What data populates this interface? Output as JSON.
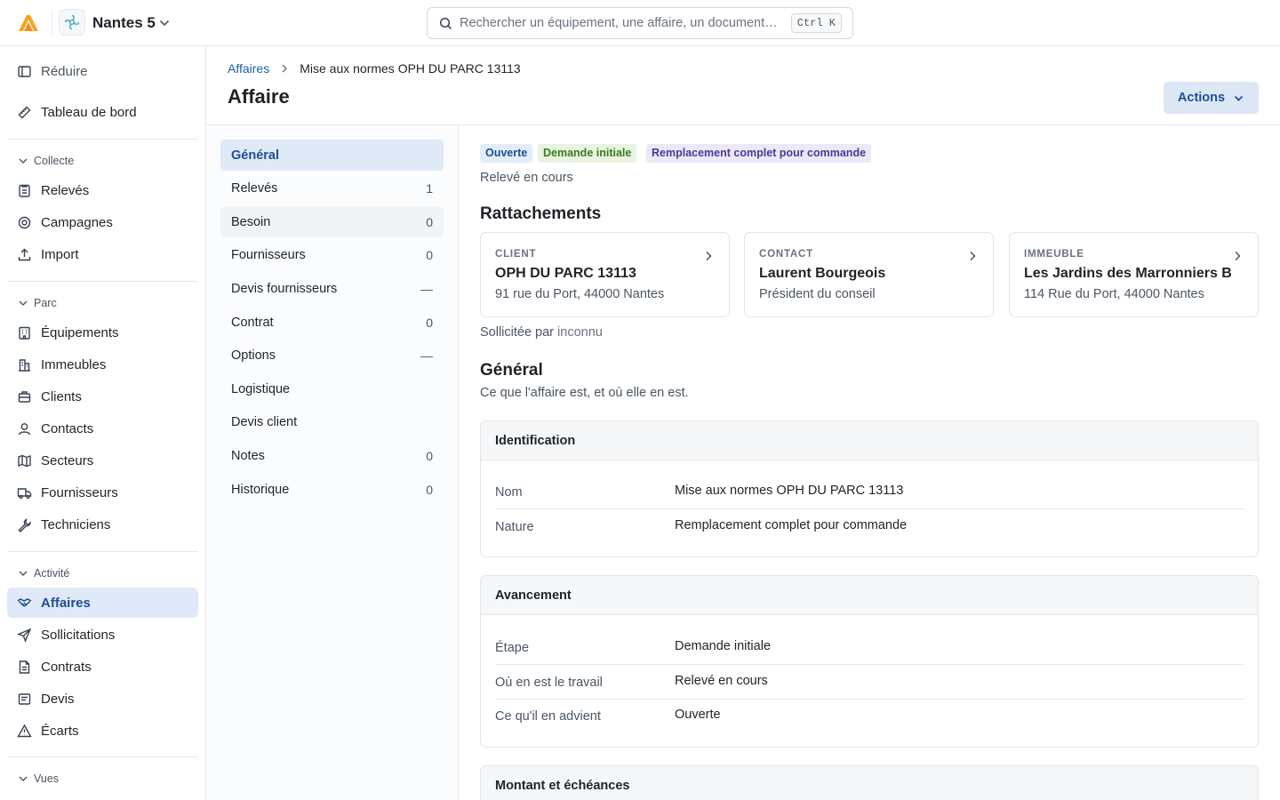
{
  "topbar": {
    "org_name": "Nantes 5",
    "search_placeholder": "Rechercher un équipement, une affaire, un document…",
    "search_shortcut": "Ctrl K"
  },
  "sidebar": {
    "collapse_label": "Réduire",
    "dashboard_label": "Tableau de bord",
    "sections": {
      "collecte": "Collecte",
      "parc": "Parc",
      "activite": "Activité",
      "vues": "Vues"
    },
    "items": {
      "releves": "Relevés",
      "campagnes": "Campagnes",
      "import": "Import",
      "equipements": "Équipements",
      "immeubles": "Immeubles",
      "clients": "Clients",
      "contacts": "Contacts",
      "secteurs": "Secteurs",
      "fournisseurs": "Fournisseurs",
      "techniciens": "Techniciens",
      "affaires": "Affaires",
      "sollicitations": "Sollicitations",
      "contrats": "Contrats",
      "devis": "Devis",
      "ecarts": "Écarts"
    }
  },
  "header": {
    "breadcrumb_root": "Affaires",
    "breadcrumb_current": "Mise aux normes OPH DU PARC 13113",
    "title": "Affaire",
    "actions_label": "Actions"
  },
  "subnav": [
    {
      "label": "Général",
      "count": ""
    },
    {
      "label": "Relevés",
      "count": "1"
    },
    {
      "label": "Besoin",
      "count": "0"
    },
    {
      "label": "Fournisseurs",
      "count": "0"
    },
    {
      "label": "Devis fournisseurs",
      "count": "—"
    },
    {
      "label": "Contrat",
      "count": "0"
    },
    {
      "label": "Options",
      "count": "—"
    },
    {
      "label": "Logistique",
      "count": ""
    },
    {
      "label": "Devis client",
      "count": ""
    },
    {
      "label": "Notes",
      "count": "0"
    },
    {
      "label": "Historique",
      "count": "0"
    }
  ],
  "main": {
    "badges": [
      "Ouverte",
      "Demande initiale",
      "Remplacement complet pour commande"
    ],
    "status_line": "Relevé en cours",
    "attachments_title": "Rattachements",
    "cards": [
      {
        "kicker": "CLIENT",
        "title": "OPH DU PARC 13113",
        "subtitle": "91 rue du Port, 44000 Nantes"
      },
      {
        "kicker": "CONTACT",
        "title": "Laurent Bourgeois",
        "subtitle": "Président du conseil"
      },
      {
        "kicker": "IMMEUBLE",
        "title": "Les Jardins des Marronniers B",
        "subtitle": "114 Rue du Port, 44000 Nantes"
      }
    ],
    "solicited_label": "Sollicitée par",
    "solicited_value": "inconnu",
    "general_title": "Général",
    "general_desc": "Ce que l'affaire est, et où elle en est.",
    "identification": {
      "title": "Identification",
      "rows": [
        {
          "key": "Nom",
          "value": "Mise aux normes OPH DU PARC 13113"
        },
        {
          "key": "Nature",
          "value": "Remplacement complet pour commande"
        }
      ]
    },
    "avancement": {
      "title": "Avancement",
      "rows": [
        {
          "key": "Étape",
          "value": "Demande initiale"
        },
        {
          "key": "Où en est le travail",
          "value": "Relevé en cours"
        },
        {
          "key": "Ce qu'il en advient",
          "value": "Ouverte"
        }
      ]
    },
    "montant": {
      "title": "Montant et échéances"
    }
  },
  "colors": {
    "accent": "#1d4f91",
    "accent_bg": "#dfe9f7",
    "logo": "#f5a524"
  }
}
